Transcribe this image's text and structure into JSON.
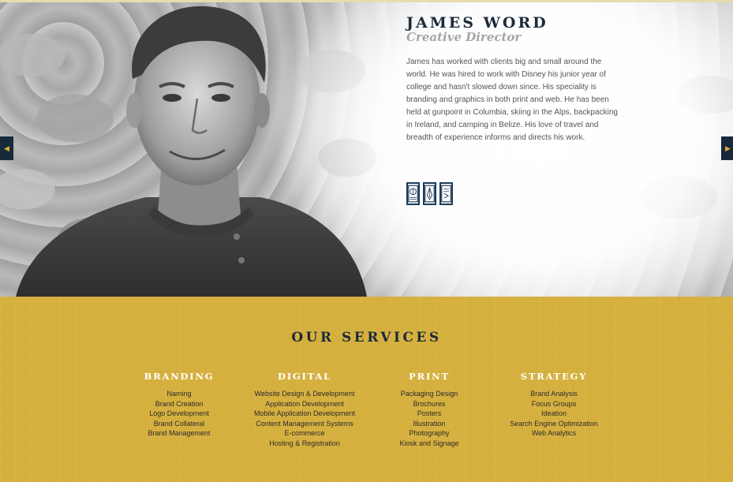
{
  "profile": {
    "name": "JAMES WORD",
    "role": "Creative Director",
    "bio": "James has worked with clients big and small around the world. He was hired to work with Disney his junior year of college and hasn't slowed down since. His speciality is branding and graphics in both print and web. He has been held at gunpoint in Columbia, skiing in the Alps, backpacking in Ireland, and camping in Belize. His love of travel and breadth of experience informs and directs his work.",
    "icons": [
      "basketball-badge-icon",
      "pen-nib-icon",
      "book-icon"
    ]
  },
  "nav": {
    "prev_icon": "◀",
    "next_icon": "▶"
  },
  "services": {
    "title": "OUR SERVICES",
    "columns": [
      {
        "heading": "BRANDING",
        "items": [
          "Naming",
          "Brand Creation",
          "Logo Development",
          "Brand Collateral",
          "Brand Management"
        ]
      },
      {
        "heading": "DIGITAL",
        "items": [
          "Website Design & Development",
          "Application Development",
          "Mobile Application Development",
          "Content Management Systems",
          "E-commerce",
          "Hosting & Registration"
        ]
      },
      {
        "heading": "PRINT",
        "items": [
          "Packaging Design",
          "Brochures",
          "Posters",
          "Illustration",
          "Photography",
          "Kiosk and Signage"
        ]
      },
      {
        "heading": "STRATEGY",
        "items": [
          "Brand Analysis",
          "Focus Groups",
          "Ideation",
          "Search Engine Optimization",
          "Web Analytics"
        ]
      }
    ]
  },
  "colors": {
    "accent": "#d6b03f",
    "navy": "#1c2a38"
  }
}
